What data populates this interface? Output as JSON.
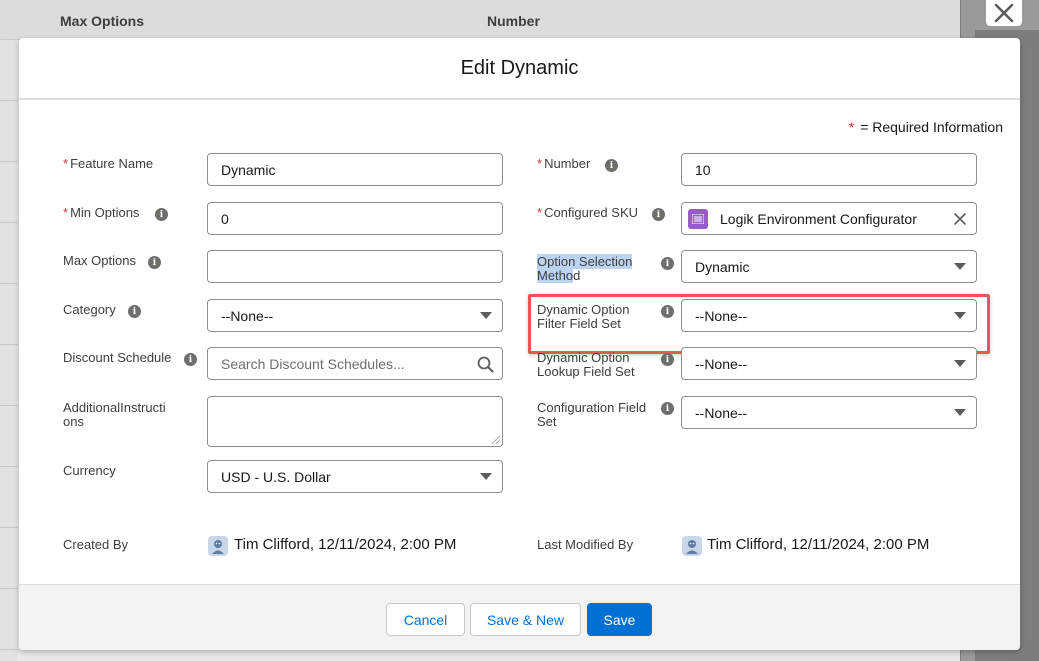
{
  "background": {
    "columns": [
      "Max Options",
      "Number"
    ]
  },
  "modal": {
    "title": "Edit Dynamic",
    "required_info": "= Required Information",
    "required_star": "*"
  },
  "fields": {
    "feature_name": {
      "label": "Feature Name",
      "value": "Dynamic",
      "required": true
    },
    "min_options": {
      "label": "Min Options",
      "value": "0",
      "required": true
    },
    "max_options": {
      "label": "Max Options",
      "value": ""
    },
    "category": {
      "label": "Category",
      "value": "--None--"
    },
    "discount_schedule": {
      "label": "Discount Schedule",
      "placeholder": "Search Discount Schedules..."
    },
    "additional_instructions": {
      "label_line1": "AdditionalInstructi",
      "label_line2": "ons",
      "value": ""
    },
    "currency": {
      "label": "Currency",
      "value": "USD - U.S. Dollar"
    },
    "number": {
      "label": "Number",
      "value": "10",
      "required": true
    },
    "configured_sku": {
      "label": "Configured SKU",
      "value": "Logik Environment Configurator",
      "required": true
    },
    "option_selection_method": {
      "label_line1": "Option Selection",
      "label_line2_selected": "Metho",
      "label_line2_rest": "d",
      "value": "Dynamic"
    },
    "dynamic_option_filter": {
      "label_line1": "Dynamic Option",
      "label_line2": "Filter Field Set",
      "value": "--None--"
    },
    "dynamic_option_lookup": {
      "label_line1": "Dynamic Option",
      "label_line2": "Lookup Field Set",
      "value": "--None--"
    },
    "configuration_field_set": {
      "label_line1": "Configuration Field",
      "label_line2": "Set",
      "value": "--None--"
    }
  },
  "audit": {
    "created_by_label": "Created By",
    "created_by_value": "Tim Clifford, 12/11/2024, 2:00 PM",
    "modified_by_label": "Last Modified By",
    "modified_by_value": "Tim Clifford, 12/11/2024, 2:00 PM"
  },
  "footer": {
    "cancel": "Cancel",
    "save_new": "Save & New",
    "save": "Save"
  },
  "colors": {
    "brand": "#0070d2",
    "required": "#c23934",
    "highlight": "#e8594d",
    "sku_icon": "#9b59d0"
  }
}
